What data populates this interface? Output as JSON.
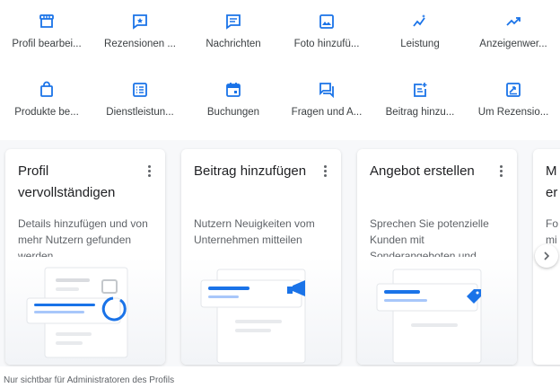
{
  "actions": [
    {
      "label": "Profil bearbei...",
      "icon": "storefront-icon"
    },
    {
      "label": "Rezensionen ...",
      "icon": "rate-review-icon"
    },
    {
      "label": "Nachrichten",
      "icon": "message-icon"
    },
    {
      "label": "Foto hinzufü...",
      "icon": "add-photo-icon"
    },
    {
      "label": "Leistung",
      "icon": "insights-icon"
    },
    {
      "label": "Anzeigenwer...",
      "icon": "trending-up-icon"
    },
    {
      "label": "Produkte be...",
      "icon": "shopping-bag-icon"
    },
    {
      "label": "Dienstleistun...",
      "icon": "list-icon"
    },
    {
      "label": "Buchungen",
      "icon": "calendar-icon"
    },
    {
      "label": "Fragen und A...",
      "icon": "question-answer-icon"
    },
    {
      "label": "Beitrag hinzu...",
      "icon": "post-add-icon"
    },
    {
      "label": "Um Rezensio...",
      "icon": "request-review-icon"
    }
  ],
  "cards": [
    {
      "title": "Profil vervollständigen",
      "description": "Details hinzufügen und von mehr Nutzern gefunden werden"
    },
    {
      "title": "Beitrag hinzufügen",
      "description": "Nutzern Neuigkeiten vom Unternehmen mitteilen"
    },
    {
      "title": "Angebot erstellen",
      "description": "Sprechen Sie potenzielle Kunden mit Sonderangeboten und..."
    },
    {
      "title": "M er",
      "description": "Fo mi"
    }
  ],
  "footer_note": "Nur sichtbar für Administratoren des Profils",
  "colors": {
    "accent": "#1a73e8",
    "text": "#3c4043",
    "muted": "#5f6368",
    "carousel_bg": "#f7f8fa"
  }
}
